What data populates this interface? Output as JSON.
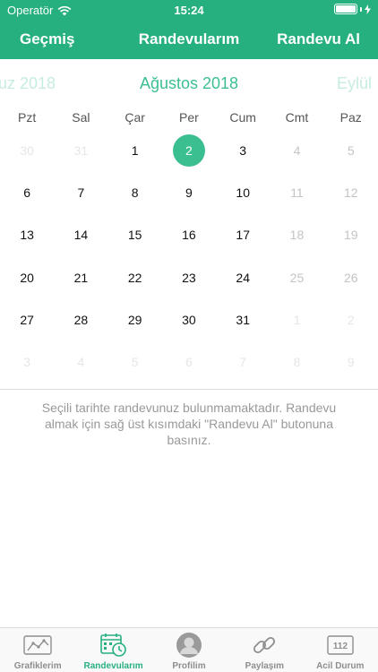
{
  "status": {
    "carrier": "Operatör",
    "time": "15:24"
  },
  "nav": {
    "left": "Geçmiş",
    "title": "Randevularım",
    "right": "Randevu Al"
  },
  "months": {
    "prev": "uz 2018",
    "current": "Ağustos 2018",
    "next": "Eylül"
  },
  "weekdays": [
    "Pzt",
    "Sal",
    "Çar",
    "Per",
    "Cum",
    "Cmt",
    "Paz"
  ],
  "days": [
    {
      "t": "30",
      "s": "outside"
    },
    {
      "t": "31",
      "s": "outside"
    },
    {
      "t": "1",
      "s": "normal"
    },
    {
      "t": "2",
      "s": "selected"
    },
    {
      "t": "3",
      "s": "normal"
    },
    {
      "t": "4",
      "s": "faded"
    },
    {
      "t": "5",
      "s": "faded"
    },
    {
      "t": "6",
      "s": "normal"
    },
    {
      "t": "7",
      "s": "normal"
    },
    {
      "t": "8",
      "s": "normal"
    },
    {
      "t": "9",
      "s": "normal"
    },
    {
      "t": "10",
      "s": "normal"
    },
    {
      "t": "11",
      "s": "faded"
    },
    {
      "t": "12",
      "s": "faded"
    },
    {
      "t": "13",
      "s": "normal"
    },
    {
      "t": "14",
      "s": "normal"
    },
    {
      "t": "15",
      "s": "normal"
    },
    {
      "t": "16",
      "s": "normal"
    },
    {
      "t": "17",
      "s": "normal"
    },
    {
      "t": "18",
      "s": "faded"
    },
    {
      "t": "19",
      "s": "faded"
    },
    {
      "t": "20",
      "s": "normal"
    },
    {
      "t": "21",
      "s": "normal"
    },
    {
      "t": "22",
      "s": "normal"
    },
    {
      "t": "23",
      "s": "normal"
    },
    {
      "t": "24",
      "s": "normal"
    },
    {
      "t": "25",
      "s": "faded"
    },
    {
      "t": "26",
      "s": "faded"
    },
    {
      "t": "27",
      "s": "normal"
    },
    {
      "t": "28",
      "s": "normal"
    },
    {
      "t": "29",
      "s": "normal"
    },
    {
      "t": "30",
      "s": "normal"
    },
    {
      "t": "31",
      "s": "normal"
    },
    {
      "t": "1",
      "s": "outside"
    },
    {
      "t": "2",
      "s": "outside"
    },
    {
      "t": "3",
      "s": "outside"
    },
    {
      "t": "4",
      "s": "outside"
    },
    {
      "t": "5",
      "s": "outside"
    },
    {
      "t": "6",
      "s": "outside"
    },
    {
      "t": "7",
      "s": "outside"
    },
    {
      "t": "8",
      "s": "outside"
    },
    {
      "t": "9",
      "s": "outside"
    }
  ],
  "message": "Seçili tarihte randevunuz bulunmamaktadır. Randevu almak için sağ üst kısımdaki \"Randevu Al\" butonuna basınız.",
  "tabs": {
    "charts": "Grafiklerim",
    "appointments": "Randevularım",
    "profile": "Profilim",
    "share": "Paylaşım",
    "emergency": "Acil Durum",
    "emergency_number": "112"
  },
  "colors": {
    "brand": "#27b07f",
    "accent": "#3cbf90",
    "inactive": "#8e8e8e"
  }
}
